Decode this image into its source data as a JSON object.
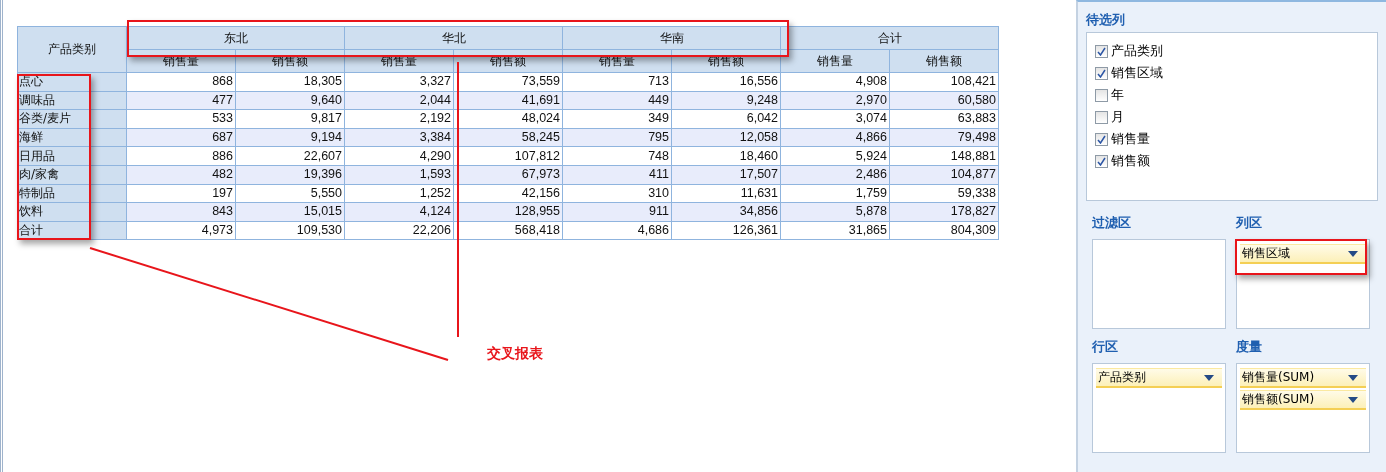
{
  "table": {
    "corner": "产品类别",
    "groups": [
      {
        "label": "东北",
        "measures": [
          "销售量",
          "销售额"
        ]
      },
      {
        "label": "华北",
        "measures": [
          "销售量",
          "销售额"
        ]
      },
      {
        "label": "华南",
        "measures": [
          "销售量",
          "销售额"
        ]
      },
      {
        "label": "合计",
        "measures": [
          "销售量",
          "销售额"
        ]
      }
    ],
    "rows": [
      {
        "label": "点心",
        "cells": [
          "868",
          "18,305",
          "3,327",
          "73,559",
          "713",
          "16,556",
          "4,908",
          "108,421"
        ]
      },
      {
        "label": "调味品",
        "cells": [
          "477",
          "9,640",
          "2,044",
          "41,691",
          "449",
          "9,248",
          "2,970",
          "60,580"
        ]
      },
      {
        "label": "谷类/麦片",
        "cells": [
          "533",
          "9,817",
          "2,192",
          "48,024",
          "349",
          "6,042",
          "3,074",
          "63,883"
        ]
      },
      {
        "label": "海鲜",
        "cells": [
          "687",
          "9,194",
          "3,384",
          "58,245",
          "795",
          "12,058",
          "4,866",
          "79,498"
        ]
      },
      {
        "label": "日用品",
        "cells": [
          "886",
          "22,607",
          "4,290",
          "107,812",
          "748",
          "18,460",
          "5,924",
          "148,881"
        ]
      },
      {
        "label": "肉/家禽",
        "cells": [
          "482",
          "19,396",
          "1,593",
          "67,973",
          "411",
          "17,507",
          "2,486",
          "104,877"
        ]
      },
      {
        "label": "特制品",
        "cells": [
          "197",
          "5,550",
          "1,252",
          "42,156",
          "310",
          "11,631",
          "1,759",
          "59,338"
        ]
      },
      {
        "label": "饮料",
        "cells": [
          "843",
          "15,015",
          "4,124",
          "128,955",
          "911",
          "34,856",
          "5,878",
          "178,827"
        ]
      },
      {
        "label": "合计",
        "cells": [
          "4,973",
          "109,530",
          "22,206",
          "568,418",
          "4,686",
          "126,361",
          "31,865",
          "804,309"
        ]
      }
    ]
  },
  "annotation": {
    "label": "交叉报表"
  },
  "panel": {
    "title": "待选列",
    "fields": [
      {
        "label": "产品类别",
        "checked": true
      },
      {
        "label": "销售区域",
        "checked": true
      },
      {
        "label": "年",
        "checked": false
      },
      {
        "label": "月",
        "checked": false
      },
      {
        "label": "销售量",
        "checked": true
      },
      {
        "label": "销售额",
        "checked": true
      }
    ],
    "zones": [
      {
        "title": "过滤区"
      },
      {
        "title": "列区",
        "items": [
          "销售区域"
        ]
      },
      {
        "title": "行区",
        "items": [
          "产品类别"
        ]
      },
      {
        "title": "度量",
        "items": [
          "销售量(SUM)",
          "销售额(SUM)"
        ]
      }
    ]
  }
}
